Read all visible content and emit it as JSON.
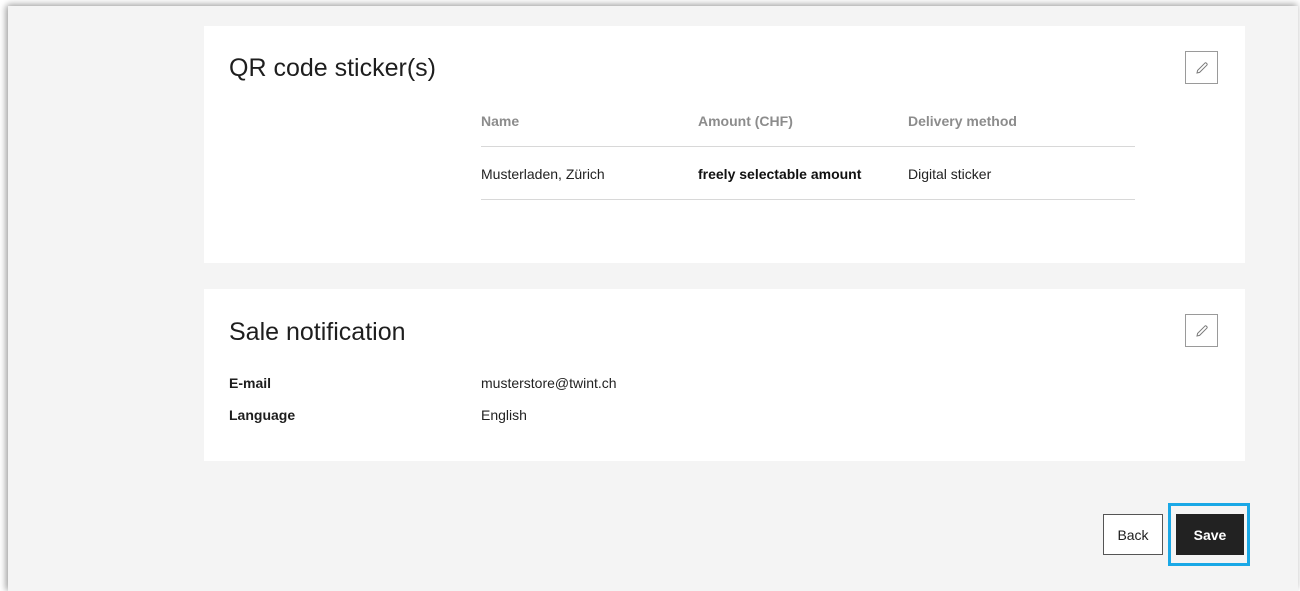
{
  "qr_section": {
    "title": "QR code sticker(s)",
    "edit_icon": "pencil-icon",
    "columns": [
      "Name",
      "Amount (CHF)",
      "Delivery method"
    ],
    "rows": [
      {
        "name": "Musterladen, Zürich",
        "amount": "freely selectable amount",
        "delivery": "Digital sticker"
      }
    ]
  },
  "sale_section": {
    "title": "Sale notification",
    "edit_icon": "pencil-icon",
    "fields": [
      {
        "label": "E-mail",
        "value": "musterstore@twint.ch"
      },
      {
        "label": "Language",
        "value": "English"
      }
    ]
  },
  "actions": {
    "back_label": "Back",
    "save_label": "Save",
    "highlight_color": "#1aa8e6"
  }
}
